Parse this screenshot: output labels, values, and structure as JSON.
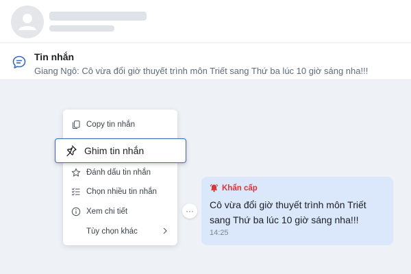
{
  "pinned_banner": {
    "title": "Tin nhắn",
    "text": "Giang Ngô: Cô vừa đổi giờ thuyết trình môn Triết sang Thứ ba lúc 10 giờ sáng nha!!!",
    "icon": "chat-bubble-icon"
  },
  "context_menu": {
    "items": [
      {
        "label": "Copy tin nhắn",
        "icon": "copy-icon"
      },
      {
        "label": "Ghim tin nhắn",
        "icon": "pin-icon",
        "highlighted": true
      },
      {
        "label": "Đánh dấu tin nhắn",
        "icon": "star-icon"
      },
      {
        "label": "Chọn nhiều tin nhắn",
        "icon": "checklist-icon"
      },
      {
        "label": "Xem chi tiết",
        "icon": "info-icon"
      },
      {
        "label": "Tùy chọn khác",
        "icon": "chevron-right-icon"
      }
    ]
  },
  "more_button": {
    "label": "···"
  },
  "message": {
    "tag": "Khẩn cấp",
    "tag_icon": "alarm-bell-icon",
    "text": "Cô vừa đổi giờ thuyết trình môn Triết sang Thứ ba lúc 10 giờ sáng nha!!!",
    "time": "14:25"
  },
  "colors": {
    "accent": "#3566c8",
    "urgent": "#d8343a",
    "bubble": "#dbe8fb",
    "background": "#eef1f5"
  }
}
